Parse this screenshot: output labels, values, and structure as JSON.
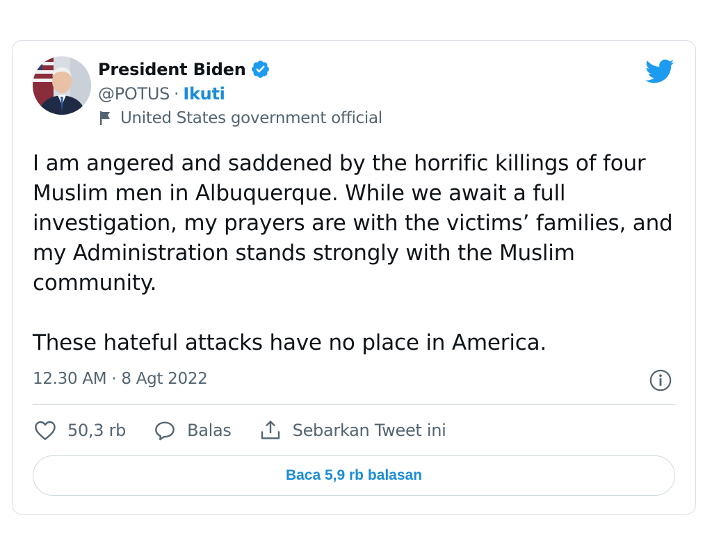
{
  "author": {
    "name": "President Biden",
    "handle": "@POTUS",
    "separator": "·",
    "follow_label": "Ikuti",
    "label": "United States government official",
    "verified": true
  },
  "tweet": {
    "paragraphs": [
      "I am angered and saddened by the horrific killings of four Muslim men in Albuquerque. While we await a full investigation, my prayers are with the victims’ families, and my Administration stands strongly with the Muslim community.",
      "These hateful attacks have no place in America."
    ],
    "timestamp": "12.30 AM · 8 Agt 2022"
  },
  "actions": {
    "likes_count": "50,3 rb",
    "reply_label": "Balas",
    "share_label": "Sebarkan Tweet ini"
  },
  "read_replies_label": "Baca 5,9 rb balasan",
  "icons": {
    "brand": "twitter-bird-icon",
    "verified": "verified-badge-icon",
    "government_label": "flag-icon",
    "info": "info-icon",
    "like": "heart-icon",
    "reply": "speech-bubble-icon",
    "share": "share-icon"
  },
  "colors": {
    "brand_blue": "#1d9bf0",
    "link_blue": "#1a8cd8",
    "text_primary": "#0f1419",
    "text_secondary": "#536471",
    "border": "#cfd9de"
  }
}
